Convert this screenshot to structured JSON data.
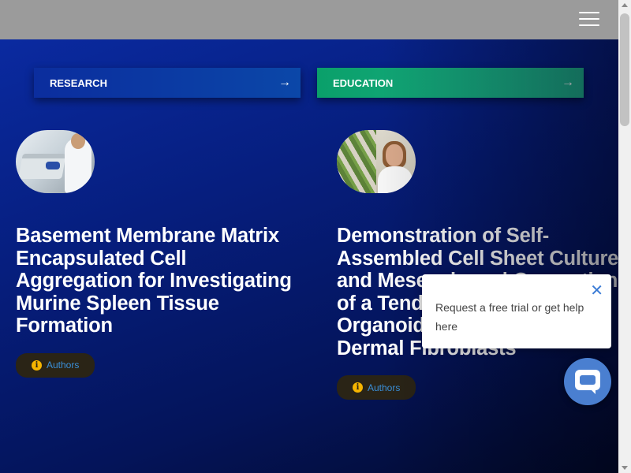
{
  "header": {
    "menu_icon": "hamburger-menu-icon"
  },
  "categories": [
    {
      "label": "RESEARCH",
      "icon": "arrow-right-icon",
      "color": "#0b2d9e"
    },
    {
      "label": "EDUCATION",
      "icon": "arrow-right-icon",
      "color": "#0aa06a"
    }
  ],
  "articles": [
    {
      "title": "Basement Membrane Matrix Encapsulated Cell Aggregation for Investigating Murine Spleen Tissue Formation",
      "authors_label": "Authors",
      "info_icon": "i"
    },
    {
      "title": "Demonstration of Self-Assembled Cell Sheet Culture and Mesenchymal Generation of a Tendon/Ligament Organoid by using Human Dermal Fibroblasts",
      "authors_label": "Authors",
      "info_icon": "i"
    }
  ],
  "chat_popup": {
    "message": "Request a free trial or get help here",
    "close_icon": "✕"
  },
  "colors": {
    "background": "#061a5e",
    "header": "#9b9b9b",
    "authors_text": "#3a8fd9",
    "info_icon": "#f5b400",
    "chat_button": "#4a7fd0"
  }
}
